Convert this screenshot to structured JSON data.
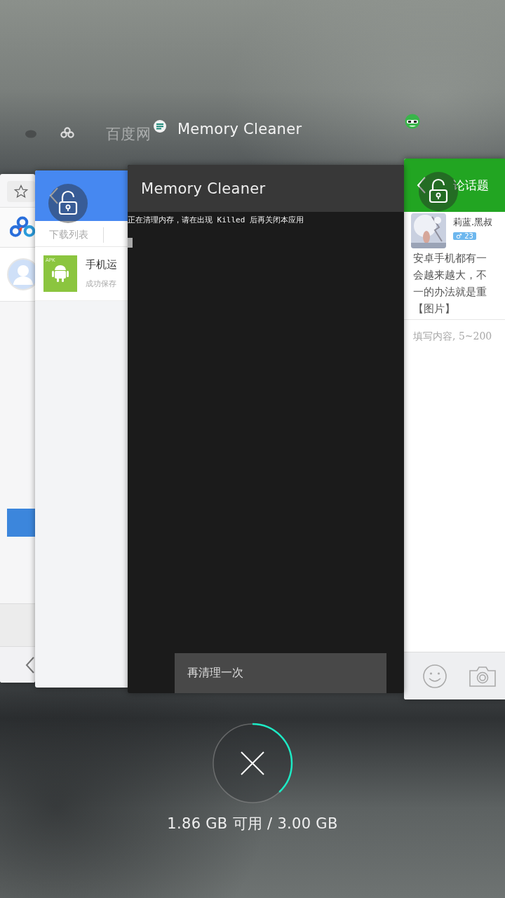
{
  "app_labels": [
    {
      "text": "百度网",
      "faded": true
    },
    {
      "text": "Memory Cleaner",
      "faded": false
    }
  ],
  "cards": [
    {
      "kind": "browser",
      "locked": false
    },
    {
      "kind": "downloads",
      "locked": true,
      "tab": "下载列表",
      "file_badge": "APK",
      "file_name": "手机运",
      "file_status": "成功保存"
    },
    {
      "kind": "terminal",
      "locked": false,
      "title": "Memory Cleaner",
      "output": "正在清理内存，请在出现 Killed 后再关闭本应用",
      "button": "再清理一次"
    },
    {
      "kind": "forum",
      "locked": true,
      "title": "论话题",
      "user": "莉蓝.黑叔",
      "badge": "♂ 23",
      "lines": [
        "安卓手机都有一",
        "会越来越大，不",
        "一的办法就是重",
        "【图片】"
      ],
      "placeholder": "填写内容, 5~200"
    }
  ],
  "memory": {
    "text": "1.86 GB 可用 / 3.00 GB",
    "level": 0.38
  }
}
